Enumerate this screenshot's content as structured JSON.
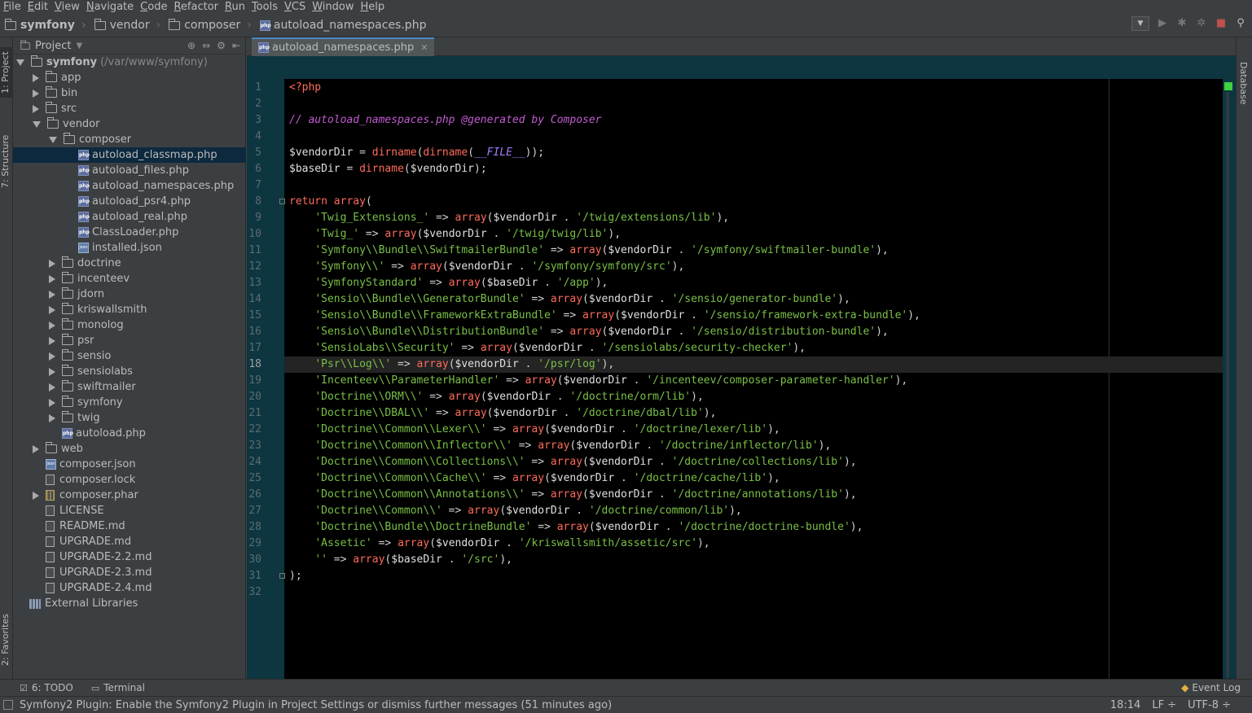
{
  "menu": [
    "File",
    "Edit",
    "View",
    "Navigate",
    "Code",
    "Refactor",
    "Run",
    "Tools",
    "VCS",
    "Window",
    "Help"
  ],
  "breadcrumb": [
    "symfony",
    "vendor",
    "composer",
    "autoload_namespaces.php"
  ],
  "left_tabs": {
    "project": "1: Project",
    "structure": "7: Structure",
    "favorites": "2: Favorites"
  },
  "right_tabs": {
    "database": "Database"
  },
  "project": {
    "header": "Project",
    "root_name": "symfony",
    "root_path": "(/var/www/symfony)",
    "items": [
      {
        "label": "app",
        "kind": "folder",
        "depth": 1,
        "state": "collapsed"
      },
      {
        "label": "bin",
        "kind": "folder",
        "depth": 1,
        "state": "collapsed"
      },
      {
        "label": "src",
        "kind": "folder",
        "depth": 1,
        "state": "collapsed"
      },
      {
        "label": "vendor",
        "kind": "folder",
        "depth": 1,
        "state": "expanded"
      },
      {
        "label": "composer",
        "kind": "folder",
        "depth": 2,
        "state": "expanded"
      },
      {
        "label": "autoload_classmap.php",
        "kind": "php",
        "depth": 3,
        "selected": true
      },
      {
        "label": "autoload_files.php",
        "kind": "php",
        "depth": 3
      },
      {
        "label": "autoload_namespaces.php",
        "kind": "php",
        "depth": 3
      },
      {
        "label": "autoload_psr4.php",
        "kind": "php",
        "depth": 3
      },
      {
        "label": "autoload_real.php",
        "kind": "php",
        "depth": 3
      },
      {
        "label": "ClassLoader.php",
        "kind": "php",
        "depth": 3
      },
      {
        "label": "installed.json",
        "kind": "json",
        "depth": 3
      },
      {
        "label": "doctrine",
        "kind": "folder",
        "depth": 2,
        "state": "collapsed"
      },
      {
        "label": "incenteev",
        "kind": "folder",
        "depth": 2,
        "state": "collapsed"
      },
      {
        "label": "jdorn",
        "kind": "folder",
        "depth": 2,
        "state": "collapsed"
      },
      {
        "label": "kriswallsmith",
        "kind": "folder",
        "depth": 2,
        "state": "collapsed"
      },
      {
        "label": "monolog",
        "kind": "folder",
        "depth": 2,
        "state": "collapsed"
      },
      {
        "label": "psr",
        "kind": "folder",
        "depth": 2,
        "state": "collapsed"
      },
      {
        "label": "sensio",
        "kind": "folder",
        "depth": 2,
        "state": "collapsed"
      },
      {
        "label": "sensiolabs",
        "kind": "folder",
        "depth": 2,
        "state": "collapsed"
      },
      {
        "label": "swiftmailer",
        "kind": "folder",
        "depth": 2,
        "state": "collapsed"
      },
      {
        "label": "symfony",
        "kind": "folder",
        "depth": 2,
        "state": "collapsed"
      },
      {
        "label": "twig",
        "kind": "folder",
        "depth": 2,
        "state": "collapsed"
      },
      {
        "label": "autoload.php",
        "kind": "php",
        "depth": 2
      },
      {
        "label": "web",
        "kind": "folder",
        "depth": 1,
        "state": "collapsed"
      },
      {
        "label": "composer.json",
        "kind": "json",
        "depth": 1
      },
      {
        "label": "composer.lock",
        "kind": "file",
        "depth": 1
      },
      {
        "label": "composer.phar",
        "kind": "phar",
        "depth": 1,
        "state": "collapsed"
      },
      {
        "label": "LICENSE",
        "kind": "file",
        "depth": 1
      },
      {
        "label": "README.md",
        "kind": "file",
        "depth": 1
      },
      {
        "label": "UPGRADE.md",
        "kind": "file",
        "depth": 1
      },
      {
        "label": "UPGRADE-2.2.md",
        "kind": "file",
        "depth": 1
      },
      {
        "label": "UPGRADE-2.3.md",
        "kind": "file",
        "depth": 1
      },
      {
        "label": "UPGRADE-2.4.md",
        "kind": "file",
        "depth": 1
      }
    ],
    "external": "External Libraries"
  },
  "editor": {
    "tab_label": "autoload_namespaces.php",
    "current_line": 18,
    "lines": [
      [
        [
          "kw",
          "<?php"
        ]
      ],
      [],
      [
        [
          "cmt",
          "// autoload_namespaces.php @generated by Composer"
        ]
      ],
      [],
      [
        [
          "var",
          "$vendorDir"
        ],
        [
          "op",
          " = "
        ],
        [
          "fn",
          "dirname"
        ],
        [
          "op",
          "("
        ],
        [
          "fn",
          "dirname"
        ],
        [
          "op",
          "("
        ],
        [
          "const",
          "__FILE__"
        ],
        [
          "op",
          "));"
        ]
      ],
      [
        [
          "var",
          "$baseDir"
        ],
        [
          "op",
          " = "
        ],
        [
          "fn",
          "dirname"
        ],
        [
          "op",
          "("
        ],
        [
          "var",
          "$vendorDir"
        ],
        [
          "op",
          ");"
        ]
      ],
      [],
      [
        [
          "kw",
          "return "
        ],
        [
          "fn",
          "array"
        ],
        [
          "op",
          "("
        ]
      ],
      [
        [
          "op",
          "    "
        ],
        [
          "str",
          "'Twig_Extensions_'"
        ],
        [
          "op",
          " => "
        ],
        [
          "fn",
          "array"
        ],
        [
          "op",
          "("
        ],
        [
          "var",
          "$vendorDir"
        ],
        [
          "op",
          " . "
        ],
        [
          "str",
          "'/twig/extensions/lib'"
        ],
        [
          "op",
          "),"
        ]
      ],
      [
        [
          "op",
          "    "
        ],
        [
          "str",
          "'Twig_'"
        ],
        [
          "op",
          " => "
        ],
        [
          "fn",
          "array"
        ],
        [
          "op",
          "("
        ],
        [
          "var",
          "$vendorDir"
        ],
        [
          "op",
          " . "
        ],
        [
          "str",
          "'/twig/twig/lib'"
        ],
        [
          "op",
          "),"
        ]
      ],
      [
        [
          "op",
          "    "
        ],
        [
          "str",
          "'Symfony\\\\Bundle\\\\SwiftmailerBundle'"
        ],
        [
          "op",
          " => "
        ],
        [
          "fn",
          "array"
        ],
        [
          "op",
          "("
        ],
        [
          "var",
          "$vendorDir"
        ],
        [
          "op",
          " . "
        ],
        [
          "str",
          "'/symfony/swiftmailer-bundle'"
        ],
        [
          "op",
          "),"
        ]
      ],
      [
        [
          "op",
          "    "
        ],
        [
          "str",
          "'Symfony\\\\'"
        ],
        [
          "op",
          " => "
        ],
        [
          "fn",
          "array"
        ],
        [
          "op",
          "("
        ],
        [
          "var",
          "$vendorDir"
        ],
        [
          "op",
          " . "
        ],
        [
          "str",
          "'/symfony/symfony/src'"
        ],
        [
          "op",
          "),"
        ]
      ],
      [
        [
          "op",
          "    "
        ],
        [
          "str",
          "'SymfonyStandard'"
        ],
        [
          "op",
          " => "
        ],
        [
          "fn",
          "array"
        ],
        [
          "op",
          "("
        ],
        [
          "var",
          "$baseDir"
        ],
        [
          "op",
          " . "
        ],
        [
          "str",
          "'/app'"
        ],
        [
          "op",
          "),"
        ]
      ],
      [
        [
          "op",
          "    "
        ],
        [
          "str",
          "'Sensio\\\\Bundle\\\\GeneratorBundle'"
        ],
        [
          "op",
          " => "
        ],
        [
          "fn",
          "array"
        ],
        [
          "op",
          "("
        ],
        [
          "var",
          "$vendorDir"
        ],
        [
          "op",
          " . "
        ],
        [
          "str",
          "'/sensio/generator-bundle'"
        ],
        [
          "op",
          "),"
        ]
      ],
      [
        [
          "op",
          "    "
        ],
        [
          "str",
          "'Sensio\\\\Bundle\\\\FrameworkExtraBundle'"
        ],
        [
          "op",
          " => "
        ],
        [
          "fn",
          "array"
        ],
        [
          "op",
          "("
        ],
        [
          "var",
          "$vendorDir"
        ],
        [
          "op",
          " . "
        ],
        [
          "str",
          "'/sensio/framework-extra-bundle'"
        ],
        [
          "op",
          "),"
        ]
      ],
      [
        [
          "op",
          "    "
        ],
        [
          "str",
          "'Sensio\\\\Bundle\\\\DistributionBundle'"
        ],
        [
          "op",
          " => "
        ],
        [
          "fn",
          "array"
        ],
        [
          "op",
          "("
        ],
        [
          "var",
          "$vendorDir"
        ],
        [
          "op",
          " . "
        ],
        [
          "str",
          "'/sensio/distribution-bundle'"
        ],
        [
          "op",
          "),"
        ]
      ],
      [
        [
          "op",
          "    "
        ],
        [
          "str",
          "'SensioLabs\\\\Security'"
        ],
        [
          "op",
          " => "
        ],
        [
          "fn",
          "array"
        ],
        [
          "op",
          "("
        ],
        [
          "var",
          "$vendorDir"
        ],
        [
          "op",
          " . "
        ],
        [
          "str",
          "'/sensiolabs/security-checker'"
        ],
        [
          "op",
          "),"
        ]
      ],
      [
        [
          "op",
          "    "
        ],
        [
          "str",
          "'Psr\\\\Log\\\\'"
        ],
        [
          "op",
          " => "
        ],
        [
          "fn",
          "array"
        ],
        [
          "op",
          "("
        ],
        [
          "var",
          "$vendorDir"
        ],
        [
          "op",
          " . "
        ],
        [
          "str",
          "'/psr/log'"
        ],
        [
          "op",
          "),"
        ]
      ],
      [
        [
          "op",
          "    "
        ],
        [
          "str",
          "'Incenteev\\\\ParameterHandler'"
        ],
        [
          "op",
          " => "
        ],
        [
          "fn",
          "array"
        ],
        [
          "op",
          "("
        ],
        [
          "var",
          "$vendorDir"
        ],
        [
          "op",
          " . "
        ],
        [
          "str",
          "'/incenteev/composer-parameter-handler'"
        ],
        [
          "op",
          "),"
        ]
      ],
      [
        [
          "op",
          "    "
        ],
        [
          "str",
          "'Doctrine\\\\ORM\\\\'"
        ],
        [
          "op",
          " => "
        ],
        [
          "fn",
          "array"
        ],
        [
          "op",
          "("
        ],
        [
          "var",
          "$vendorDir"
        ],
        [
          "op",
          " . "
        ],
        [
          "str",
          "'/doctrine/orm/lib'"
        ],
        [
          "op",
          "),"
        ]
      ],
      [
        [
          "op",
          "    "
        ],
        [
          "str",
          "'Doctrine\\\\DBAL\\\\'"
        ],
        [
          "op",
          " => "
        ],
        [
          "fn",
          "array"
        ],
        [
          "op",
          "("
        ],
        [
          "var",
          "$vendorDir"
        ],
        [
          "op",
          " . "
        ],
        [
          "str",
          "'/doctrine/dbal/lib'"
        ],
        [
          "op",
          "),"
        ]
      ],
      [
        [
          "op",
          "    "
        ],
        [
          "str",
          "'Doctrine\\\\Common\\\\Lexer\\\\'"
        ],
        [
          "op",
          " => "
        ],
        [
          "fn",
          "array"
        ],
        [
          "op",
          "("
        ],
        [
          "var",
          "$vendorDir"
        ],
        [
          "op",
          " . "
        ],
        [
          "str",
          "'/doctrine/lexer/lib'"
        ],
        [
          "op",
          "),"
        ]
      ],
      [
        [
          "op",
          "    "
        ],
        [
          "str",
          "'Doctrine\\\\Common\\\\Inflector\\\\'"
        ],
        [
          "op",
          " => "
        ],
        [
          "fn",
          "array"
        ],
        [
          "op",
          "("
        ],
        [
          "var",
          "$vendorDir"
        ],
        [
          "op",
          " . "
        ],
        [
          "str",
          "'/doctrine/inflector/lib'"
        ],
        [
          "op",
          "),"
        ]
      ],
      [
        [
          "op",
          "    "
        ],
        [
          "str",
          "'Doctrine\\\\Common\\\\Collections\\\\'"
        ],
        [
          "op",
          " => "
        ],
        [
          "fn",
          "array"
        ],
        [
          "op",
          "("
        ],
        [
          "var",
          "$vendorDir"
        ],
        [
          "op",
          " . "
        ],
        [
          "str",
          "'/doctrine/collections/lib'"
        ],
        [
          "op",
          "),"
        ]
      ],
      [
        [
          "op",
          "    "
        ],
        [
          "str",
          "'Doctrine\\\\Common\\\\Cache\\\\'"
        ],
        [
          "op",
          " => "
        ],
        [
          "fn",
          "array"
        ],
        [
          "op",
          "("
        ],
        [
          "var",
          "$vendorDir"
        ],
        [
          "op",
          " . "
        ],
        [
          "str",
          "'/doctrine/cache/lib'"
        ],
        [
          "op",
          "),"
        ]
      ],
      [
        [
          "op",
          "    "
        ],
        [
          "str",
          "'Doctrine\\\\Common\\\\Annotations\\\\'"
        ],
        [
          "op",
          " => "
        ],
        [
          "fn",
          "array"
        ],
        [
          "op",
          "("
        ],
        [
          "var",
          "$vendorDir"
        ],
        [
          "op",
          " . "
        ],
        [
          "str",
          "'/doctrine/annotations/lib'"
        ],
        [
          "op",
          "),"
        ]
      ],
      [
        [
          "op",
          "    "
        ],
        [
          "str",
          "'Doctrine\\\\Common\\\\'"
        ],
        [
          "op",
          " => "
        ],
        [
          "fn",
          "array"
        ],
        [
          "op",
          "("
        ],
        [
          "var",
          "$vendorDir"
        ],
        [
          "op",
          " . "
        ],
        [
          "str",
          "'/doctrine/common/lib'"
        ],
        [
          "op",
          "),"
        ]
      ],
      [
        [
          "op",
          "    "
        ],
        [
          "str",
          "'Doctrine\\\\Bundle\\\\DoctrineBundle'"
        ],
        [
          "op",
          " => "
        ],
        [
          "fn",
          "array"
        ],
        [
          "op",
          "("
        ],
        [
          "var",
          "$vendorDir"
        ],
        [
          "op",
          " . "
        ],
        [
          "str",
          "'/doctrine/doctrine-bundle'"
        ],
        [
          "op",
          "),"
        ]
      ],
      [
        [
          "op",
          "    "
        ],
        [
          "str",
          "'Assetic'"
        ],
        [
          "op",
          " => "
        ],
        [
          "fn",
          "array"
        ],
        [
          "op",
          "("
        ],
        [
          "var",
          "$vendorDir"
        ],
        [
          "op",
          " . "
        ],
        [
          "str",
          "'/kriswallsmith/assetic/src'"
        ],
        [
          "op",
          "),"
        ]
      ],
      [
        [
          "op",
          "    "
        ],
        [
          "str",
          "''"
        ],
        [
          "op",
          " => "
        ],
        [
          "fn",
          "array"
        ],
        [
          "op",
          "("
        ],
        [
          "var",
          "$baseDir"
        ],
        [
          "op",
          " . "
        ],
        [
          "str",
          "'/src'"
        ],
        [
          "op",
          "),"
        ]
      ],
      [
        [
          "op",
          ");"
        ]
      ],
      []
    ]
  },
  "bottom_tools": {
    "todo": "6: TODO",
    "terminal": "Terminal",
    "event_log": "Event Log"
  },
  "status": {
    "message": "Symfony2 Plugin: Enable the Symfony2 Plugin in Project Settings or dismiss further messages (51 minutes ago)",
    "position": "18:14",
    "line_sep": "LF ÷",
    "encoding": "UTF-8 ÷"
  },
  "colors": {
    "keyword": "#ff6b5b",
    "string": "#79c046",
    "comment": "#c15cd0",
    "selection": "#0d293e",
    "editor_bg": "#000000",
    "gutter_bg": "#0d3640"
  }
}
